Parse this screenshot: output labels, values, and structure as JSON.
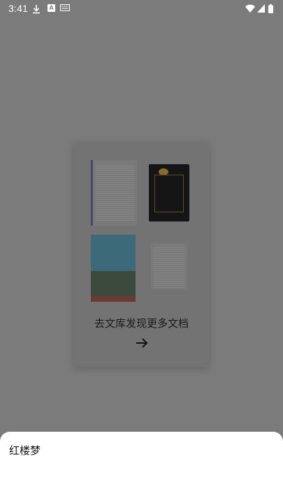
{
  "status_bar": {
    "time": "3:41",
    "icons": [
      "download-icon",
      "accessibility-icon",
      "keyboard-icon",
      "wifi-icon",
      "cell-signal-icon",
      "battery-icon"
    ]
  },
  "promo_card": {
    "cta_text": "去文库发现更多文档",
    "arrow": "arrow-right-icon"
  },
  "bottom_sheet": {
    "title": "红楼梦"
  },
  "colors": {
    "scrim": "#7b7b7b",
    "card": "#737373",
    "sheet": "#ffffff"
  }
}
